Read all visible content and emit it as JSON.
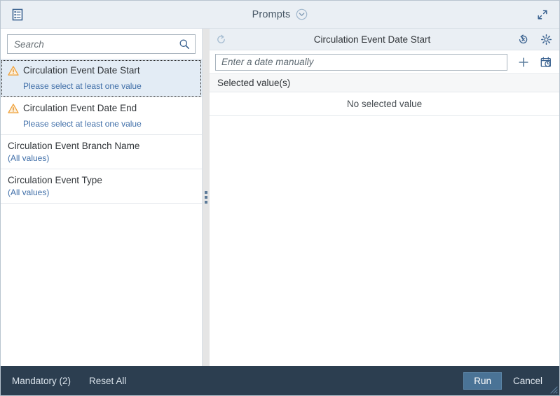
{
  "window": {
    "title": "Prompts",
    "menu_icon": "form-list-icon",
    "title_chevron_icon": "chevron-down-circle-icon",
    "expand_icon": "expand-fullscreen-icon",
    "resize_grip_icon": "resize-grip-icon"
  },
  "search": {
    "placeholder": "Search",
    "value": "",
    "icon": "search-icon"
  },
  "prompts": [
    {
      "label": "Circulation Event Date Start",
      "sub": "Please select at least one value",
      "state": "warning",
      "selected": true,
      "icon": "warning-triangle-icon"
    },
    {
      "label": "Circulation Event Date End",
      "sub": "Please select at least one value",
      "state": "warning",
      "selected": false,
      "icon": "warning-triangle-icon"
    },
    {
      "label": "Circulation Event Branch Name",
      "sub": "(All values)",
      "state": "normal",
      "selected": false,
      "icon": ""
    },
    {
      "label": "Circulation Event Type",
      "sub": "(All values)",
      "state": "normal",
      "selected": false,
      "icon": ""
    }
  ],
  "splitter": {
    "grip_icon": "splitter-grip-icon"
  },
  "detail": {
    "header_title": "Circulation Event Date Start",
    "refresh_icon": "refresh-icon",
    "clear_icon": "clear-selection-icon",
    "settings_icon": "gear-icon",
    "date_input_placeholder": "Enter a date manually",
    "date_input_value": "",
    "add_icon": "plus-icon",
    "date_picker_icon": "calendar-clock-icon",
    "selected_values_header": "Selected value(s)",
    "empty_text": "No selected value"
  },
  "footer": {
    "mandatory_label": "Mandatory (2)",
    "reset_label": "Reset All",
    "run_label": "Run",
    "cancel_label": "Cancel"
  },
  "colors": {
    "header_bg": "#eaeff4",
    "selected_row": "#e3ecf5",
    "footer_bg": "#2c3e50",
    "run_button": "#4a7396",
    "link_blue": "#3f6ea8",
    "warning_orange": "#f0a23c",
    "icon_blue": "#39618f"
  }
}
